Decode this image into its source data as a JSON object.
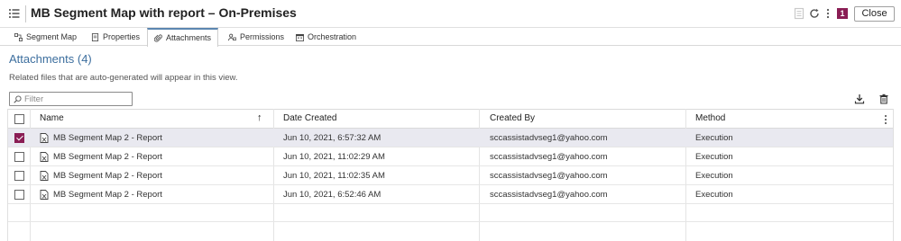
{
  "window": {
    "title": "MB Segment Map with report – On-Premises",
    "badge_count": "1",
    "close_label": "Close"
  },
  "tabs": [
    {
      "label": "Segment Map",
      "icon": "segment-map-icon",
      "active": false
    },
    {
      "label": "Properties",
      "icon": "properties-icon",
      "active": false
    },
    {
      "label": "Attachments",
      "icon": "paperclip-icon",
      "active": true
    },
    {
      "label": "Permissions",
      "icon": "permissions-icon",
      "active": false
    },
    {
      "label": "Orchestration",
      "icon": "orchestration-icon",
      "active": false
    }
  ],
  "attachments": {
    "heading": "Attachments (4)",
    "info": "Related files that are auto-generated will appear in this view.",
    "filter_placeholder": "Filter"
  },
  "table": {
    "columns": [
      "Name",
      "Date Created",
      "Created By",
      "Method"
    ],
    "sort_indicator": "↑",
    "rows": [
      {
        "name": "MB Segment Map 2 - Report",
        "date": "Jun 10, 2021, 6:57:32 AM",
        "created_by": "sccassistadvseg1@yahoo.com",
        "method": "Execution",
        "checked": true
      },
      {
        "name": "MB Segment Map 2 - Report",
        "date": "Jun 10, 2021, 11:02:29 AM",
        "created_by": "sccassistadvseg1@yahoo.com",
        "method": "Execution",
        "checked": false
      },
      {
        "name": "MB Segment Map 2 - Report",
        "date": "Jun 10, 2021, 11:02:35 AM",
        "created_by": "sccassistadvseg1@yahoo.com",
        "method": "Execution",
        "checked": false
      },
      {
        "name": "MB Segment Map 2 - Report",
        "date": "Jun 10, 2021, 6:52:46 AM",
        "created_by": "sccassistadvseg1@yahoo.com",
        "method": "Execution",
        "checked": false
      }
    ]
  },
  "colors": {
    "accent": "#8a1d54",
    "heading": "#3c6e9e",
    "selected_row": "#e9e9f0"
  }
}
